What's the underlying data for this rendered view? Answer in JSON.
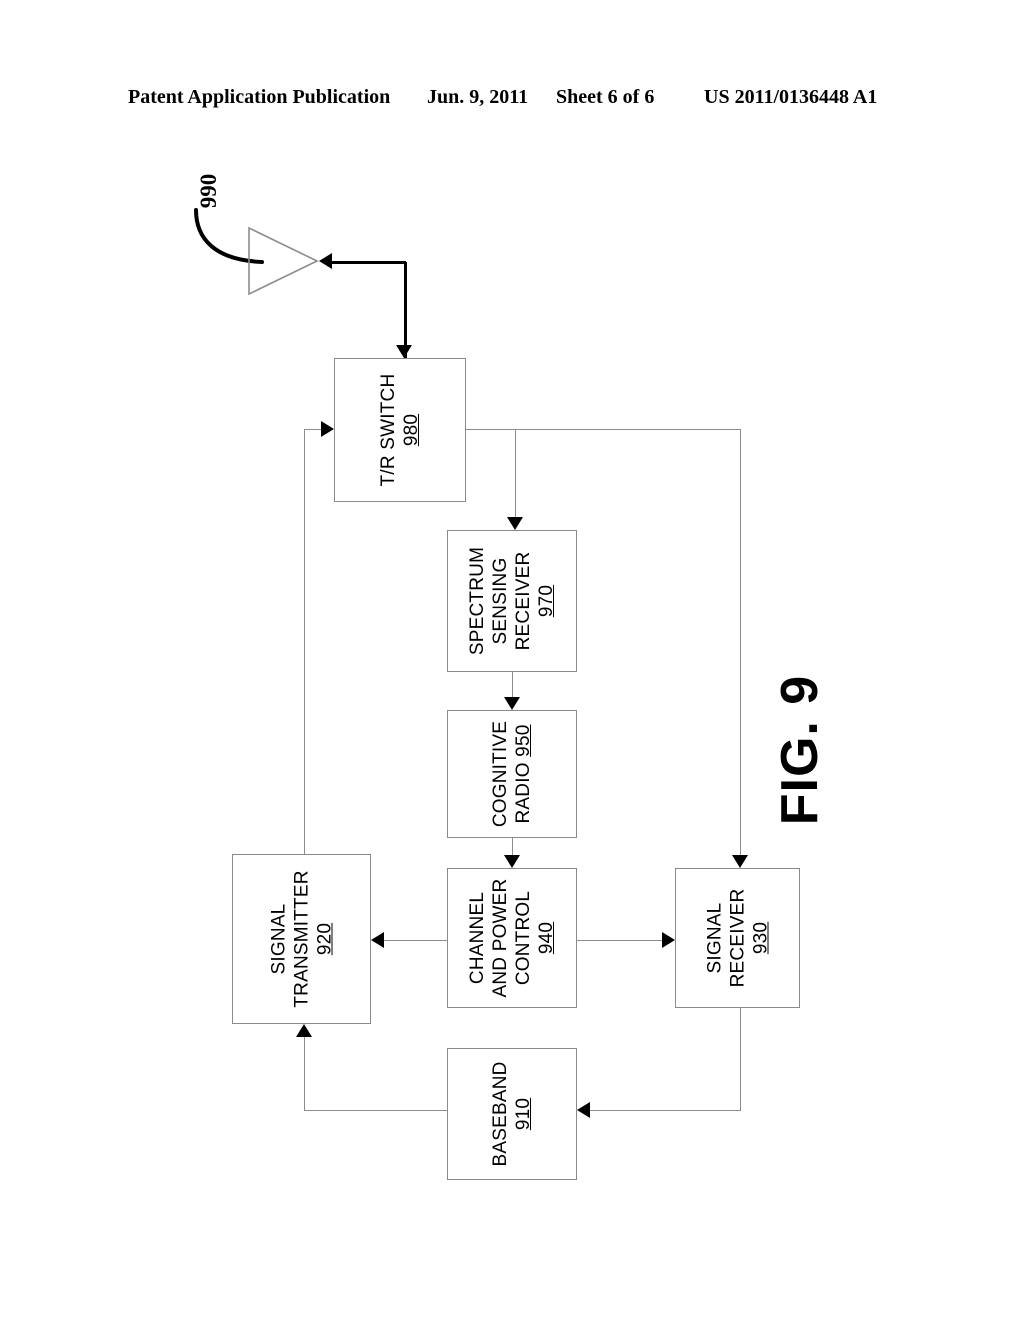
{
  "header": {
    "publication": "Patent Application Publication",
    "date": "Jun. 9, 2011",
    "sheet": "Sheet 6 of 6",
    "patent_number": "US 2011/0136448 A1"
  },
  "figure": {
    "label": "FIG. 9",
    "antenna_callout": "990"
  },
  "blocks": {
    "tr_switch": {
      "line1": "T/R SWITCH",
      "num": "980"
    },
    "spectrum_sensing": {
      "line1": "SPECTRUM",
      "line2": "SENSING",
      "line3": "RECEIVER",
      "num": "970"
    },
    "cognitive_radio": {
      "line1": "COGNITIVE",
      "line2": "RADIO",
      "num": "950"
    },
    "channel_power": {
      "line1": "CHANNEL",
      "line2": "AND POWER",
      "line3": "CONTROL",
      "num": "940"
    },
    "signal_transmitter": {
      "line1": "SIGNAL",
      "line2": "TRANSMITTER",
      "num": "920"
    },
    "signal_receiver": {
      "line1": "SIGNAL",
      "line2": "RECEIVER",
      "num": "930"
    },
    "baseband": {
      "line1": "BASEBAND",
      "num": "910"
    }
  },
  "colors": {
    "ink": "#000000",
    "line": "#8d8d8d",
    "background": "#ffffff"
  }
}
